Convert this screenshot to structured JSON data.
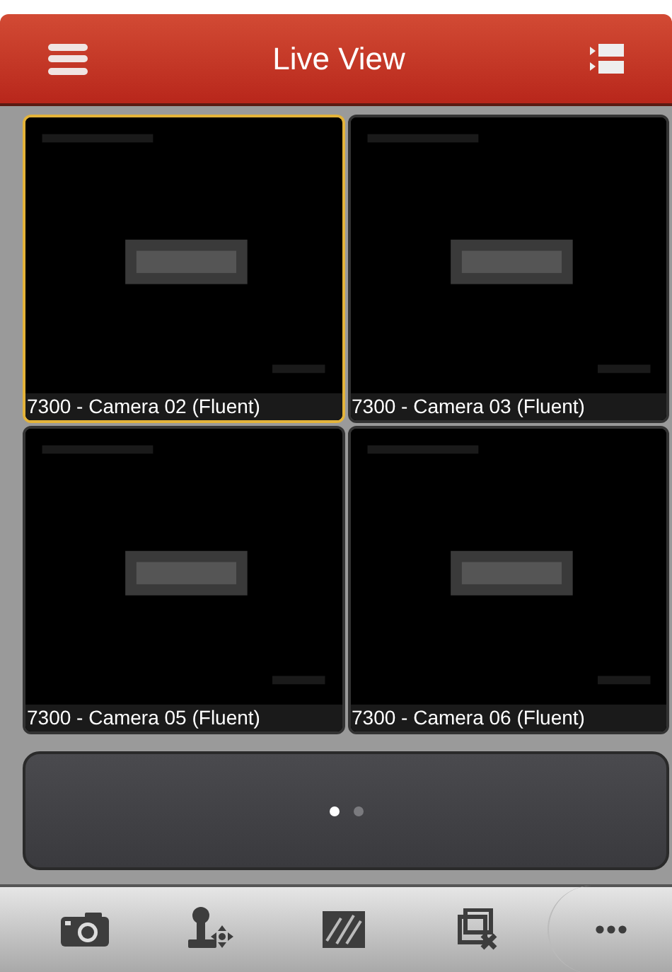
{
  "header": {
    "title": "Live View"
  },
  "cells": [
    {
      "caption": "7300 - Camera 02 (Fluent)",
      "selected": true
    },
    {
      "caption": "7300 - Camera 03 (Fluent)",
      "selected": false
    },
    {
      "caption": "7300 - Camera 05 (Fluent)",
      "selected": false
    },
    {
      "caption": "7300 - Camera 06 (Fluent)",
      "selected": false
    }
  ],
  "pager": [
    {
      "selected": true
    },
    {
      "selected": false
    }
  ],
  "toolbar": [
    {
      "kind": "capture"
    },
    {
      "kind": "ptz"
    },
    {
      "kind": "quality"
    },
    {
      "kind": "close_all"
    },
    {
      "kind": "more"
    }
  ]
}
